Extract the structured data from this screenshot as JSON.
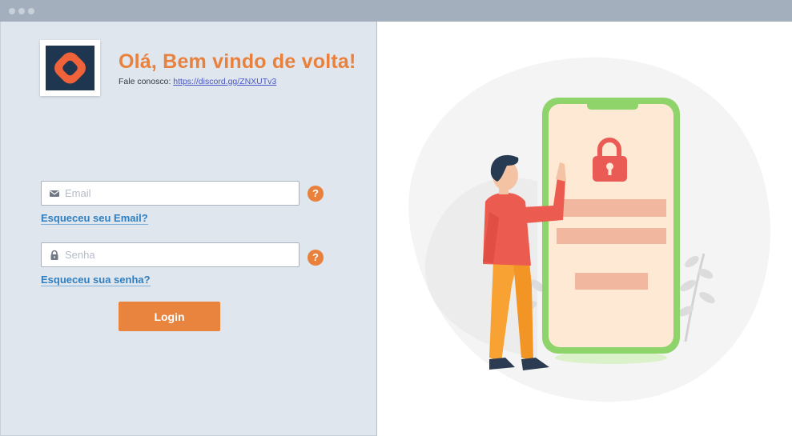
{
  "window": {
    "controls": [
      "close",
      "minimize",
      "maximize"
    ]
  },
  "brand": {
    "logo_icon": "ring-logo-icon",
    "logo_colors": [
      "#f0623a",
      "#1e3650"
    ]
  },
  "header": {
    "title": "Olá, Bem vindo de volta!",
    "contact_label": "Fale conosco:",
    "contact_link": "https://discord.gg/ZNXUTv3"
  },
  "form": {
    "email": {
      "placeholder": "Email",
      "value": "",
      "icon": "envelope-icon"
    },
    "email_help": "?",
    "forgot_email": "Esqueceu seu Email?",
    "password": {
      "placeholder": "Senha",
      "value": "",
      "icon": "lock-icon"
    },
    "password_help": "?",
    "forgot_password": "Esqueceu sua senha?",
    "login_label": "Login"
  },
  "colors": {
    "accent": "#e9803c",
    "link": "#2f7fc0",
    "panel": "#dfe6ee",
    "phone_frame": "#8fd46a"
  },
  "illustration": {
    "subject": "person-pointing-at-phone-with-padlock",
    "icon": "padlock-icon"
  }
}
